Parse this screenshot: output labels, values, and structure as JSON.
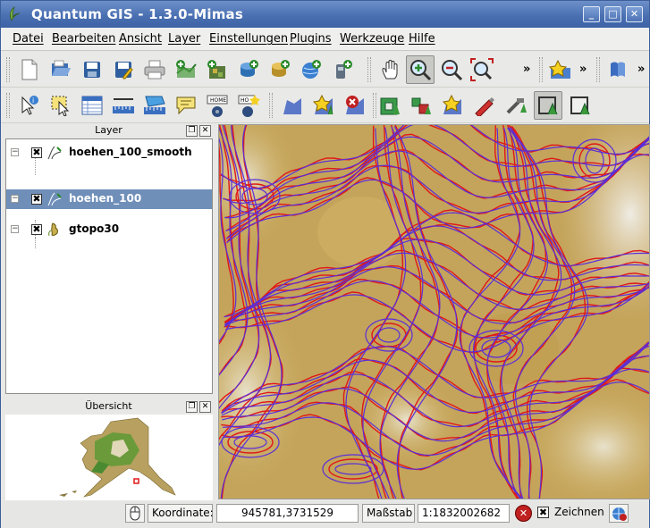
{
  "window": {
    "title": "Quantum GIS - 1.3.0-Mimas"
  },
  "menu": [
    "Datei",
    "Bearbeiten",
    "Ansicht",
    "Layer",
    "Einstellungen",
    "Plugins",
    "Werkzeuge",
    "Hilfe"
  ],
  "toolbar1": {
    "icons": [
      "new-project-icon",
      "open-project-icon",
      "save-project-icon",
      "save-as-icon",
      "print-icon",
      "add-vector-icon",
      "add-raster-icon",
      "add-postgis-icon",
      "add-spatialite-icon",
      "add-wms-icon",
      "add-wfs-icon",
      "pan-icon",
      "zoom-in-icon",
      "zoom-out-icon",
      "zoom-full-icon",
      "overflow-chevron",
      "plugin-star-icon",
      "overflow-chevron",
      "help-book-icon"
    ],
    "overflow": "»"
  },
  "toolbar2": {
    "icons": [
      "identify-icon",
      "select-icon",
      "attribute-table-icon",
      "measure-line-icon",
      "measure-area-icon",
      "map-tips-icon",
      "new-bookmark-icon",
      "show-bookmarks-icon",
      "toggle-editing-icon",
      "capture-point-icon",
      "delete-selected-icon",
      "add-ring-icon",
      "add-island-icon",
      "split-features-icon",
      "move-feature-icon",
      "node-tool-icon",
      "simplify-icon",
      "add-part-icon"
    ]
  },
  "layer_panel": {
    "title": "Layer",
    "layers": [
      {
        "name": "hoehen_100_smooth",
        "checked": "✖",
        "selected": false,
        "icon": "line-layer-icon"
      },
      {
        "name": "hoehen_100",
        "checked": "✖",
        "selected": true,
        "icon": "line-layer-icon"
      },
      {
        "name": "gtopo30",
        "checked": "✖",
        "selected": false,
        "icon": "raster-layer-icon"
      }
    ],
    "expand_glyph": "−"
  },
  "overview_panel": {
    "title": "Übersicht"
  },
  "statusbar": {
    "coord_label": "Koordinate:",
    "coord_value": "945781,3731529",
    "scale_label": "Maßstab",
    "scale_value": "1:1832002682",
    "render_label": "Zeichnen",
    "render_checked": "✖"
  },
  "colors": {
    "title_bar": "#4a70b2",
    "selection": "#6f8fb9",
    "contour_smooth": "#5a2fd8",
    "contour_raw": "#e01818",
    "terrain": "#c9a855"
  }
}
